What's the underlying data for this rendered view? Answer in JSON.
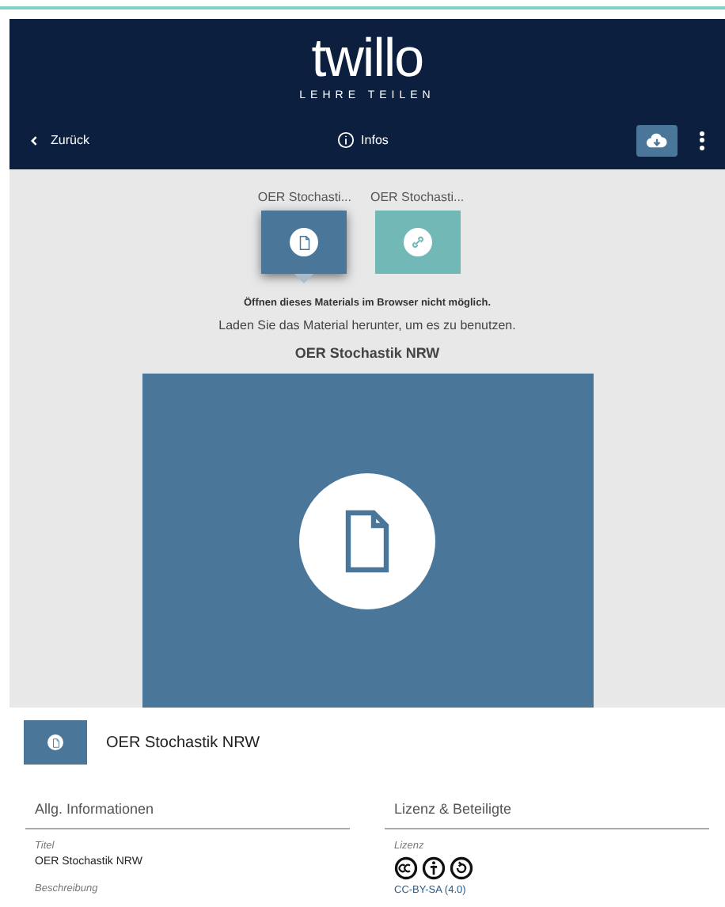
{
  "header": {
    "logo": "twillo",
    "tagline": "LEHRE TEILEN",
    "back": "Zurück",
    "info": "Infos"
  },
  "preview": {
    "thumbnails": [
      {
        "label": "OER Stochasti...",
        "kind": "document",
        "selected": true
      },
      {
        "label": "OER Stochasti...",
        "kind": "link",
        "selected": false
      }
    ],
    "notice": "Öffnen dieses Materials im Browser nicht möglich.",
    "hint": "Laden Sie das Material herunter, um es zu benutzen.",
    "title": "OER Stochastik NRW"
  },
  "item": {
    "title": "OER Stochastik NRW"
  },
  "sections": [
    {
      "heading": "Allg. Informationen",
      "fields": [
        {
          "label": "Titel",
          "value": "OER Stochastik NRW"
        },
        {
          "label": "Beschreibung"
        }
      ]
    },
    {
      "heading": "Lizenz & Beteiligte",
      "fields": [
        {
          "label": "Lizenz",
          "license_link": "CC-BY-SA (4.0)"
        }
      ]
    }
  ]
}
